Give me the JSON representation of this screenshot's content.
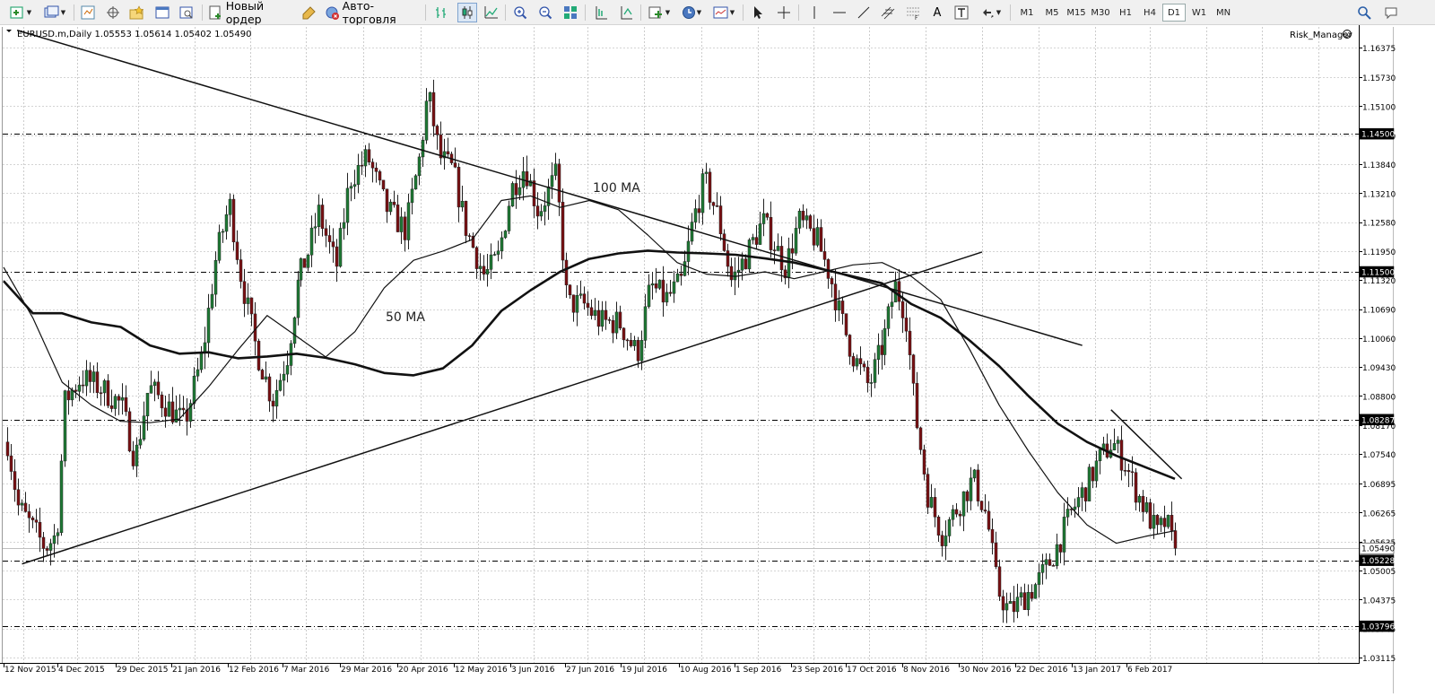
{
  "toolbar": {
    "new_order_label": "Новый ордер",
    "auto_trading_label": "Авто-торговля",
    "timeframes": [
      "M1",
      "M5",
      "M15",
      "M30",
      "H1",
      "H4",
      "D1",
      "W1",
      "MN"
    ],
    "active_timeframe": "D1",
    "text_tool_label": "A"
  },
  "chart": {
    "symbol_info": "EURUSD.m,Daily  1.05553 1.05614 1.05402 1.05490",
    "expert_label": "Risk_Manager",
    "annotations": [
      "100 MA",
      "50 MA"
    ]
  },
  "chart_data": {
    "type": "candlestick",
    "symbol": "EURUSD.m",
    "timeframe": "Daily",
    "ohlc_last": {
      "open": 1.05553,
      "high": 1.05614,
      "low": 1.05402,
      "close": 1.0549
    },
    "y_ticks": [
      "1.16375",
      "1.15730",
      "1.15100",
      "1.14460",
      "1.13840",
      "1.13210",
      "1.12580",
      "1.11950",
      "1.11320",
      "1.10690",
      "1.10060",
      "1.09430",
      "1.08800",
      "1.08170",
      "1.07540",
      "1.06895",
      "1.06265",
      "1.05635",
      "1.05005",
      "1.04375",
      "1.03745",
      "1.03115"
    ],
    "x_ticks": [
      "12 Nov 2015",
      "4 Dec 2015",
      "29 Dec 2015",
      "21 Jan 2016",
      "12 Feb 2016",
      "7 Mar 2016",
      "29 Mar 2016",
      "20 Apr 2016",
      "12 May 2016",
      "3 Jun 2016",
      "27 Jun 2016",
      "19 Jul 2016",
      "10 Aug 2016",
      "1 Sep 2016",
      "23 Sep 2016",
      "17 Oct 2016",
      "8 Nov 2016",
      "30 Nov 2016",
      "22 Dec 2016",
      "13 Jan 2017",
      "6 Feb 2017"
    ],
    "horizontal_levels": [
      {
        "label": "1.14500",
        "value": 1.145
      },
      {
        "label": "1.11500",
        "value": 1.115
      },
      {
        "label": "1.08287",
        "value": 1.08287
      },
      {
        "label": "1.05228",
        "value": 1.05228
      },
      {
        "label": "1.03796",
        "value": 1.03796
      }
    ],
    "bid_label": "1.05490",
    "ylim": [
      1.0295,
      1.1675
    ],
    "trendlines": [
      {
        "name": "descending-trendline",
        "from": [
          "8 Nov 2015",
          1.1675
        ],
        "to": [
          "8 Jan 2017",
          1.099
        ]
      },
      {
        "name": "ascending-trendline",
        "from": [
          "10 Nov 2015",
          1.0515
        ],
        "to": [
          "30 Nov 2016",
          1.1193
        ]
      },
      {
        "name": "short-trendline",
        "from": [
          "20 Jan 2017",
          1.085
        ],
        "to": [
          "20 Feb 2017",
          1.07
        ]
      }
    ],
    "series": [
      {
        "name": "100 MA",
        "values": [
          1.113,
          1.106,
          1.106,
          1.104,
          1.103,
          1.099,
          1.0972,
          1.0975,
          1.0962,
          1.0966,
          1.0972,
          1.0963,
          1.0949,
          1.093,
          1.0925,
          1.094,
          1.099,
          1.1065,
          1.111,
          1.115,
          1.1178,
          1.119,
          1.1196,
          1.1192,
          1.119,
          1.1187,
          1.1179,
          1.117,
          1.1155,
          1.114,
          1.1125,
          1.108,
          1.105,
          1.1,
          1.0945,
          1.088,
          1.082,
          1.078,
          1.075,
          1.0725,
          1.07
        ]
      },
      {
        "name": "50 MA",
        "values": [
          1.116,
          1.105,
          1.091,
          1.086,
          1.0825,
          1.0822,
          1.083,
          1.09,
          1.098,
          1.1055,
          1.101,
          1.0965,
          1.102,
          1.1115,
          1.1175,
          1.1195,
          1.122,
          1.1305,
          1.1315,
          1.129,
          1.1305,
          1.1285,
          1.123,
          1.117,
          1.1145,
          1.114,
          1.115,
          1.1135,
          1.115,
          1.1165,
          1.117,
          1.114,
          1.109,
          1.098,
          1.086,
          1.076,
          1.067,
          1.06,
          1.056,
          1.0575,
          1.0587
        ]
      }
    ]
  }
}
